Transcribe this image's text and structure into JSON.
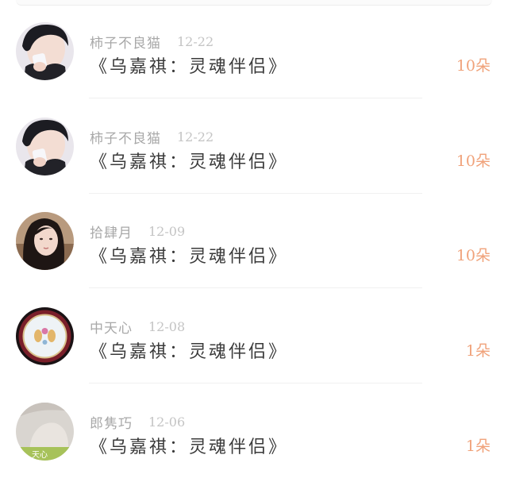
{
  "colors": {
    "username": "#a8a8a8",
    "date": "#c4c4c4",
    "title": "#3a3a3a",
    "count": "#f0a27a",
    "divider": "#f0f0f0"
  },
  "gifts": [
    {
      "avatar": "boy-in-black-avatar",
      "username": "柿子不良猫",
      "date": "12-22",
      "title": "《乌嘉祺：灵魂伴侣》",
      "count": "10朵"
    },
    {
      "avatar": "boy-in-black-avatar",
      "username": "柿子不良猫",
      "date": "12-22",
      "title": "《乌嘉祺：灵魂伴侣》",
      "count": "10朵"
    },
    {
      "avatar": "girl-long-hair-avatar",
      "username": "拾肆月",
      "date": "12-09",
      "title": "《乌嘉祺：灵魂伴侣》",
      "count": "10朵"
    },
    {
      "avatar": "decorated-plate-avatar",
      "username": "中天心",
      "date": "12-08",
      "title": "《乌嘉祺：灵魂伴侣》",
      "count": "1朵"
    },
    {
      "avatar": "sky-heart-avatar",
      "username": "郎隽巧",
      "date": "12-06",
      "title": "《乌嘉祺：灵魂伴侣》",
      "count": "1朵",
      "avatar_caption": "天心"
    }
  ]
}
